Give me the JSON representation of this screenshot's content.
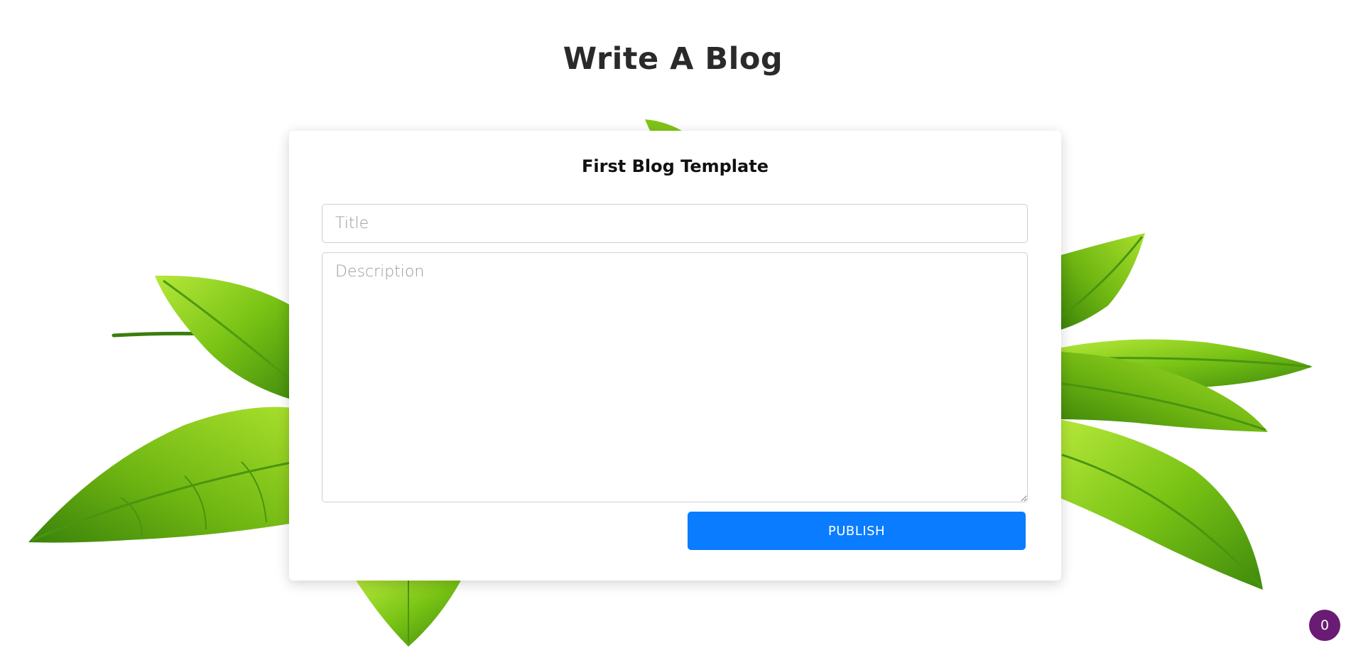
{
  "page": {
    "title": "Write A Blog"
  },
  "form": {
    "heading": "First Blog Template",
    "title_placeholder": "Title",
    "title_value": "",
    "description_placeholder": "Description",
    "description_value": "",
    "publish_label": "PUBLISH"
  },
  "badge": {
    "count": "0"
  },
  "colors": {
    "accent": "#0a7cff",
    "badge": "#6a1b74",
    "leaf_light": "#8fd21a",
    "leaf_dark": "#3f8a0c"
  },
  "icons": {
    "background": "tea-leaves-illustration"
  }
}
